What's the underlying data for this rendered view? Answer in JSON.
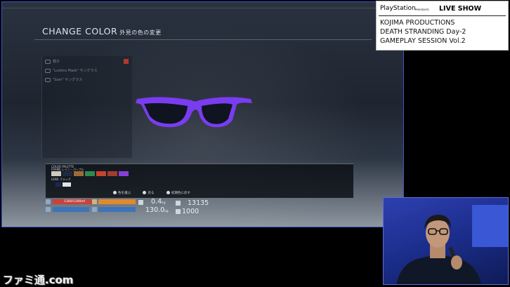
{
  "game": {
    "title": "CHANGE COLOR",
    "title_jp": "外見の色の変更",
    "list_items": [
      "帽子",
      "\"Ludens Mask\" サングラス",
      "\"Sam\" サングラス"
    ],
    "palette": {
      "header": "COLOR PALETTE",
      "frame_label": "FRAME",
      "frame_value": "レイン・パープル",
      "lens_label": "LENS",
      "lens_value": "ブラック",
      "frame_swatches": [
        "#d0cbbd",
        "#1d2a40",
        "#a06a35",
        "#2d8a4d",
        "#c8432e",
        "#a33c2c",
        "#8a3dd6"
      ]
    },
    "hints": [
      {
        "key": "△",
        "label": "色を選ぶ"
      },
      {
        "key": "✕",
        "label": "戻る"
      },
      {
        "key": "○",
        "label": "初期色に戻す"
      }
    ],
    "stats": {
      "health_text": "1300/1300ml",
      "weight": "0.4",
      "weight_unit": "kg",
      "total_weight": "130.0",
      "total_weight_unit": "kg",
      "count1": "13135",
      "count2": "1000"
    }
  },
  "overlay": {
    "brand": "PlayStation",
    "presents": "PRESENTS",
    "show": "LIVE SHOW",
    "lines": [
      "KOJIMA PRODUCTIONS",
      "DEATH STRANDING Day-2",
      "GAMEPLAY SESSION Vol.2"
    ]
  },
  "watermark": "ファミ通.com",
  "colors": {
    "frame_purple": "#7a3cf0",
    "lens": "#0f1420",
    "health": "#c8423a",
    "stamina": "#e08a2e",
    "blue_bar": "#3d74b8",
    "border_blue": "#3b55c8"
  }
}
